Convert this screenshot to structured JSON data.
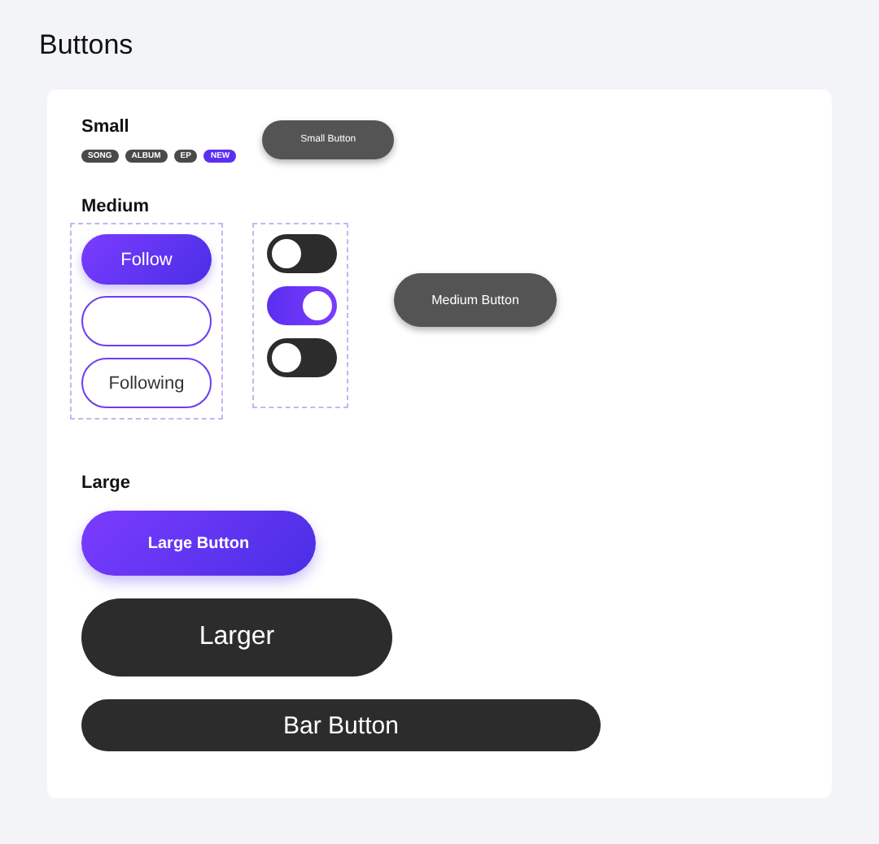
{
  "title": "Buttons",
  "small": {
    "heading": "Small",
    "tags": [
      {
        "label": "SONG",
        "color": "#4a4a4a"
      },
      {
        "label": "ALBUM",
        "color": "#4a4a4a"
      },
      {
        "label": "EP",
        "color": "#4a4a4a"
      },
      {
        "label": "NEW",
        "color": "#5b2ff0"
      }
    ],
    "button": "Small Button"
  },
  "medium": {
    "heading": "Medium",
    "follow_buttons": [
      {
        "kind": "filled",
        "label": "Follow"
      },
      {
        "kind": "outline"
      },
      {
        "kind": "outline",
        "label": "Following"
      }
    ],
    "toggles": [
      {
        "on": false
      },
      {
        "on": true
      },
      {
        "on": false
      }
    ],
    "button": "Medium Button"
  },
  "large": {
    "heading": "Large",
    "buttons": [
      {
        "kind": "gradient",
        "label": "Large Button"
      },
      {
        "kind": "larger",
        "label": "Larger"
      },
      {
        "kind": "bar",
        "label": "Bar Button"
      }
    ]
  }
}
